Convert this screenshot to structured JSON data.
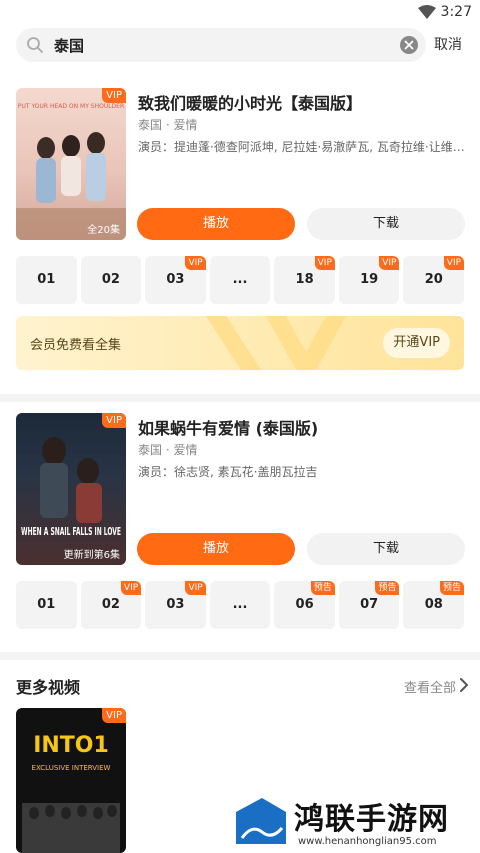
{
  "status": {
    "time": "3:27"
  },
  "search": {
    "query": "泰国",
    "cancel": "取消"
  },
  "results": [
    {
      "title": "致我们暖暖的小时光【泰国版】",
      "genre": "泰国 · 爱情",
      "cast": "演员：提迪蓬·德查阿派坤, 尼拉娃·易澈萨瓦, 瓦奇拉维·让维…",
      "badge": "VIP",
      "poster_caption": "全20集",
      "poster_text": "PUT YOUR HEAD ON MY SHOULDER",
      "play": "播放",
      "download": "下载",
      "episodes": [
        {
          "label": "01",
          "tag": ""
        },
        {
          "label": "02",
          "tag": ""
        },
        {
          "label": "03",
          "tag": "VIP"
        },
        {
          "label": "...",
          "tag": ""
        },
        {
          "label": "18",
          "tag": "VIP"
        },
        {
          "label": "19",
          "tag": "VIP"
        },
        {
          "label": "20",
          "tag": "VIP"
        }
      ],
      "vip_banner": {
        "text": "会员免费看全集",
        "button": "开通VIP"
      }
    },
    {
      "title": "如果蜗牛有爱情 (泰国版)",
      "genre": "泰国 · 爱情",
      "cast": "演员：徐志贤, 素瓦花·盖朋瓦拉吉",
      "badge": "VIP",
      "poster_caption": "更新到第6集",
      "poster_text": "WHEN A SNAIL FALLS IN LOVE",
      "play": "播放",
      "download": "下载",
      "episodes": [
        {
          "label": "01",
          "tag": ""
        },
        {
          "label": "02",
          "tag": "VIP"
        },
        {
          "label": "03",
          "tag": "VIP"
        },
        {
          "label": "...",
          "tag": ""
        },
        {
          "label": "06",
          "tag": "预告"
        },
        {
          "label": "07",
          "tag": "预告"
        },
        {
          "label": "08",
          "tag": "预告"
        }
      ]
    }
  ],
  "more": {
    "title": "更多视频",
    "link": "查看全部",
    "items": [
      {
        "badge": "VIP",
        "poster_title": "INTO1",
        "poster_sub": "EXCLUSIVE INTERVIEW"
      }
    ]
  },
  "watermark": {
    "brand": "鸿联手游网",
    "url": "www.henanhonglian95.com"
  },
  "colors": {
    "accent": "#ff6a13",
    "badge": "#ff6b1a",
    "vip_banner": "#ffe39a"
  }
}
